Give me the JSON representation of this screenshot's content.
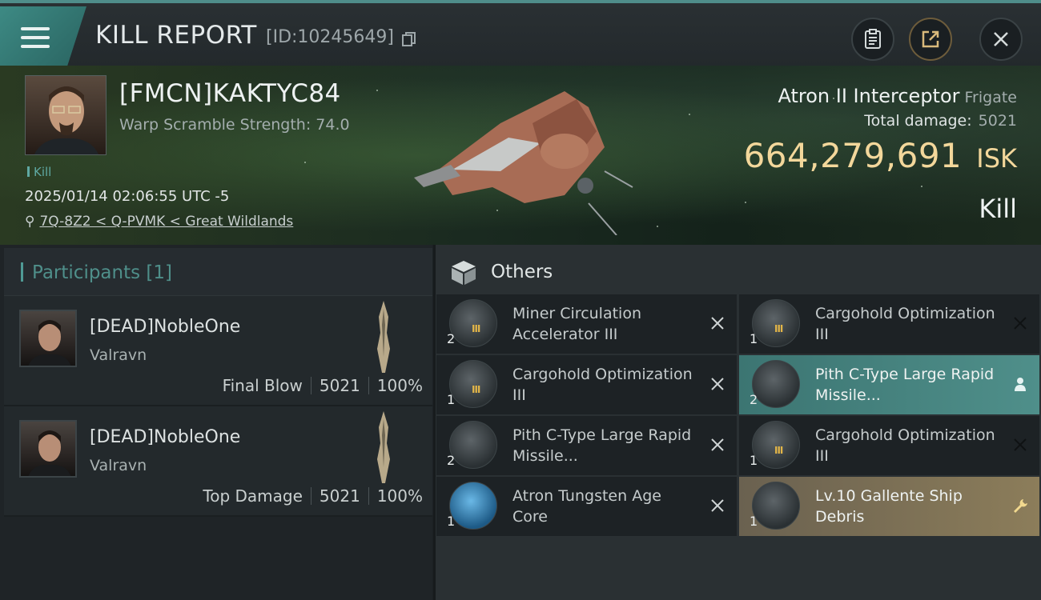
{
  "header": {
    "title": "KILL REPORT",
    "report_id": "[ID:10245649]"
  },
  "victim": {
    "name": "[FMCN]KAKTYC84",
    "warp_scramble": "Warp Scramble Strength: 74.0",
    "tag": "Kill",
    "datetime": "2025/01/14 02:06:55 UTC -5",
    "location": "7Q-8Z2 < Q-PVMK < Great Wildlands",
    "ship": "Atron II Interceptor",
    "ship_class": "Frigate",
    "total_damage_label": "Total damage:",
    "total_damage": "5021",
    "isk_value": "664,279,691",
    "isk_unit": "ISK",
    "result": "Kill"
  },
  "participants": {
    "title": "Participants [1]",
    "items": [
      {
        "name": "[DEAD]NobleOne",
        "ship": "Valravn",
        "role": "Final Blow",
        "damage": "5021",
        "percent": "100%"
      },
      {
        "name": "[DEAD]NobleOne",
        "ship": "Valravn",
        "role": "Top Damage",
        "damage": "5021",
        "percent": "100%"
      }
    ]
  },
  "others": {
    "title": "Others",
    "items": [
      {
        "name": "Miner Circulation Accelerator III",
        "qty": "2",
        "icon": "module-icon",
        "action": "destroyed-icon",
        "tier": "III"
      },
      {
        "name": "Cargohold Optimization III",
        "qty": "1",
        "icon": "cargohold-icon",
        "action": "destroyed-icon",
        "tier": "III"
      },
      {
        "name": "Cargohold Optimization III",
        "qty": "1",
        "icon": "cargohold-icon",
        "action": "destroyed-icon",
        "tier": "III"
      },
      {
        "name": "Pith C-Type Large Rapid Missile...",
        "qty": "2",
        "icon": "launcher-icon",
        "action": "person-icon",
        "tier": "",
        "highlight": "teal"
      },
      {
        "name": "Pith C-Type Large Rapid Missile...",
        "qty": "2",
        "icon": "launcher-icon",
        "action": "destroyed-icon",
        "tier": ""
      },
      {
        "name": "Cargohold Optimization III",
        "qty": "1",
        "icon": "cargohold-icon",
        "action": "destroyed-icon",
        "tier": "III"
      },
      {
        "name": "Atron Tungsten Age Core",
        "qty": "1",
        "icon": "core-icon",
        "action": "destroyed-icon",
        "tier": ""
      },
      {
        "name": "Lv.10 Gallente Ship Debris",
        "qty": "1",
        "icon": "debris-icon",
        "action": "wrench-icon",
        "tier": "",
        "highlight": "gold"
      }
    ]
  },
  "colors": {
    "accent_teal": "#4f8f8a",
    "isk_gold": "#f3d79b",
    "highlight_gold": "#8c7d5a"
  }
}
